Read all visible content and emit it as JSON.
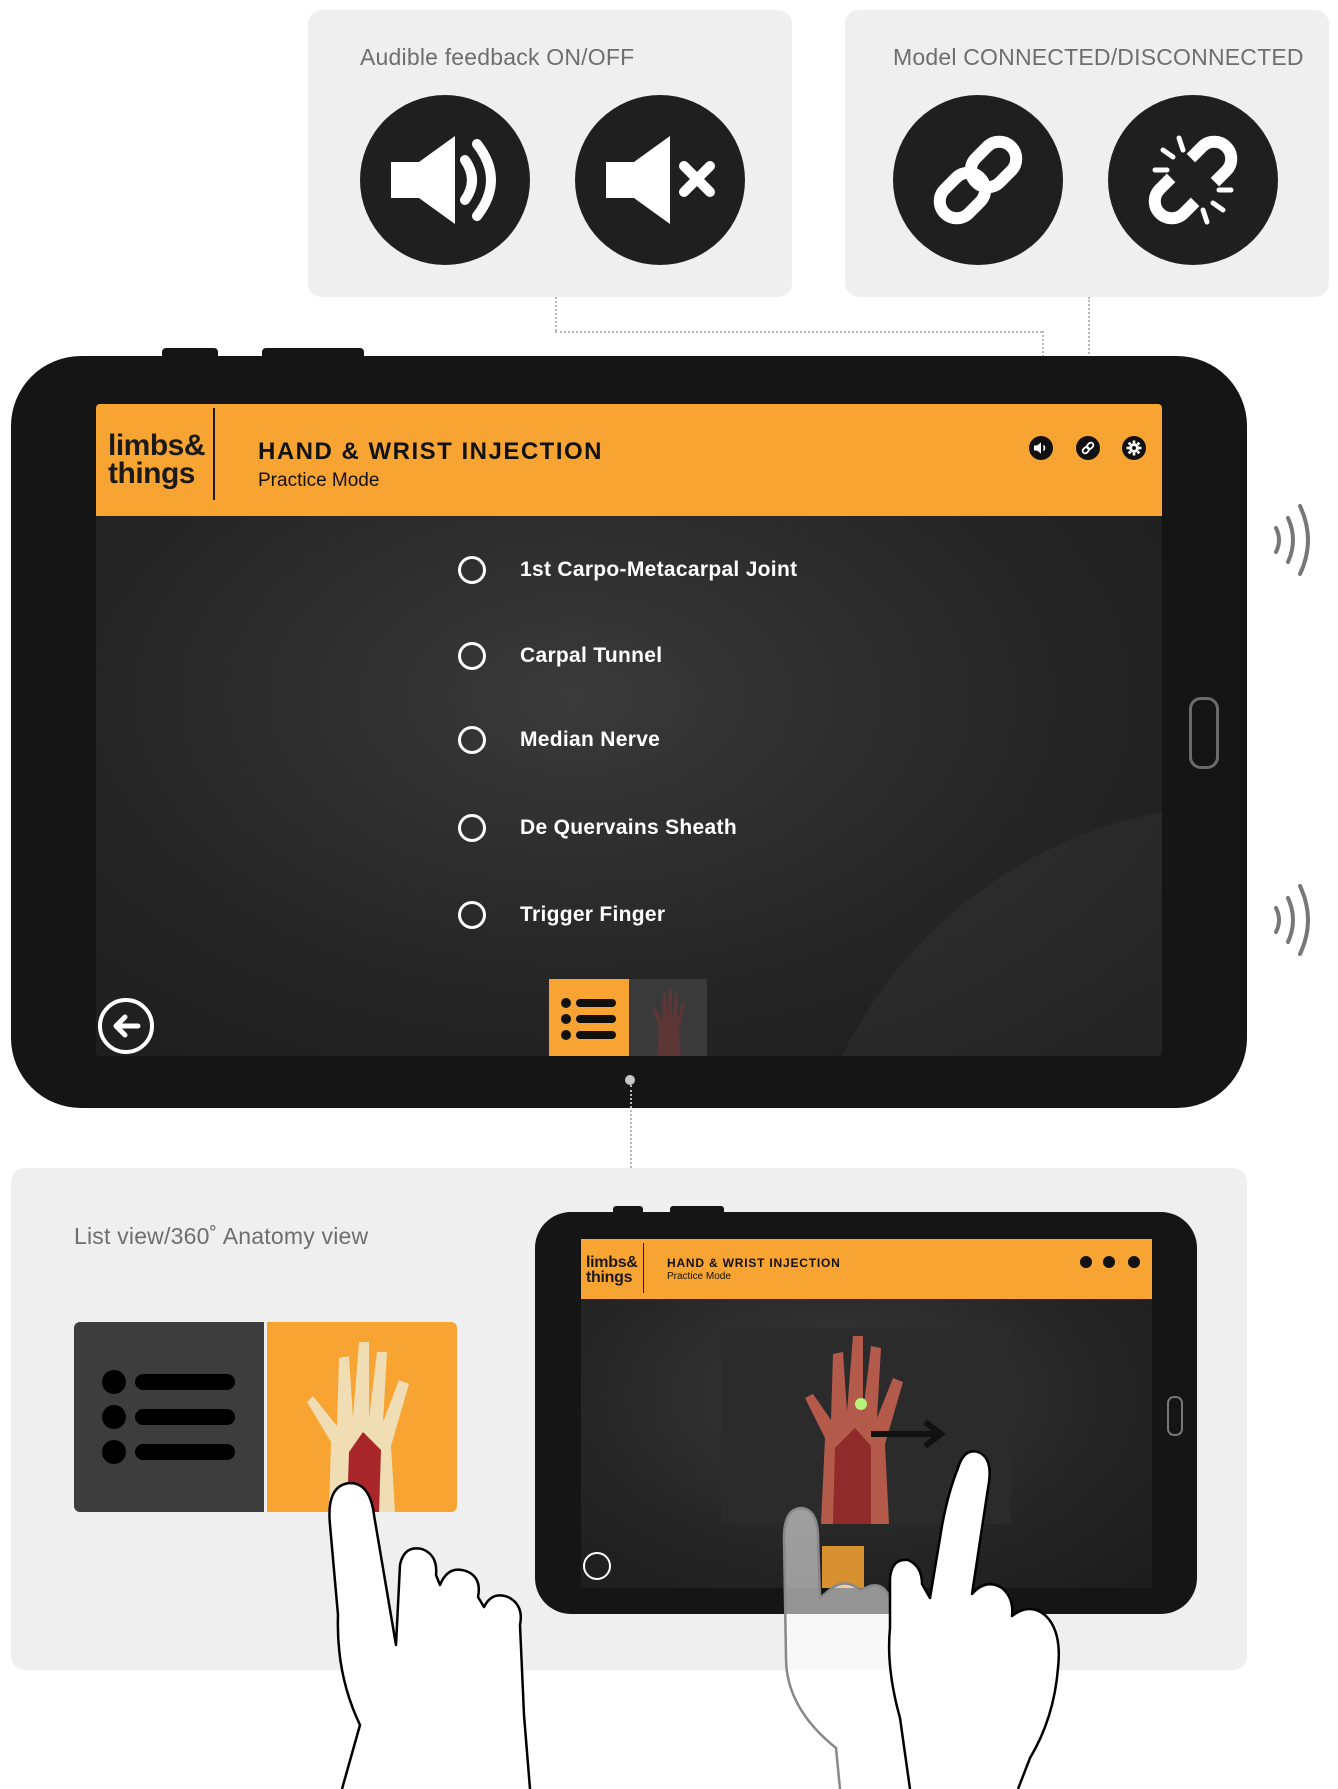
{
  "callouts": {
    "audio": {
      "title": "Audible feedback ON/OFF",
      "icons": [
        "speaker-on-icon",
        "speaker-off-icon"
      ]
    },
    "model": {
      "title": "Model CONNECTED/DISCONNECTED",
      "icons": [
        "link-connected-icon",
        "link-broken-icon"
      ]
    }
  },
  "app": {
    "logo_line1": "limbs&",
    "logo_line2": "things",
    "title": "HAND & WRIST INJECTION",
    "subtitle": "Practice Mode",
    "header_icons": [
      "speaker-icon",
      "link-icon",
      "gear-icon"
    ]
  },
  "list": {
    "items": [
      {
        "label": "1st Carpo-Metacarpal Joint"
      },
      {
        "label": "Carpal Tunnel"
      },
      {
        "label": "Median Nerve"
      },
      {
        "label": "De Quervains Sheath"
      },
      {
        "label": "Trigger Finger"
      }
    ]
  },
  "tabs": {
    "list": "list-view-icon",
    "anatomy": "anatomy-view-thumbnail"
  },
  "bottom": {
    "title": "List view/360˚ Anatomy view"
  },
  "colors": {
    "accent": "#f8a432",
    "dark": "#151515",
    "panel": "#efefef"
  }
}
